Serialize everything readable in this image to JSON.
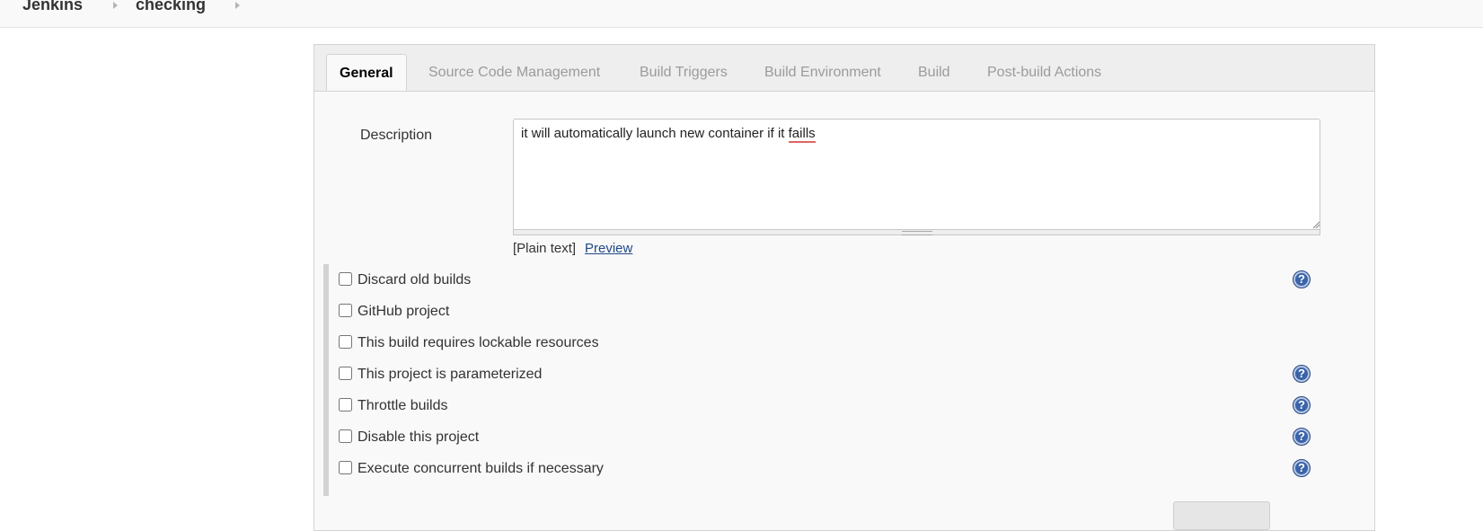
{
  "breadcrumb": {
    "items": [
      "Jenkins",
      "checking"
    ]
  },
  "tabs": [
    {
      "label": "General",
      "active": true
    },
    {
      "label": "Source Code Management",
      "active": false
    },
    {
      "label": "Build Triggers",
      "active": false
    },
    {
      "label": "Build Environment",
      "active": false
    },
    {
      "label": "Build",
      "active": false
    },
    {
      "label": "Post-build Actions",
      "active": false
    }
  ],
  "description": {
    "label": "Description",
    "text_before": "it will automatically launch new container if it ",
    "text_misspelled": "faills",
    "markup_note": "[Plain text]",
    "preview_link": "Preview"
  },
  "options": [
    {
      "label": "Discard old builds",
      "checked": false,
      "has_help": true
    },
    {
      "label": "GitHub project",
      "checked": false,
      "has_help": false
    },
    {
      "label": "This build requires lockable resources",
      "checked": false,
      "has_help": false
    },
    {
      "label": "This project is parameterized",
      "checked": false,
      "has_help": true
    },
    {
      "label": "Throttle builds",
      "checked": false,
      "has_help": true
    },
    {
      "label": "Disable this project",
      "checked": false,
      "has_help": true
    },
    {
      "label": "Execute concurrent builds if necessary",
      "checked": false,
      "has_help": true
    }
  ],
  "icons": {
    "help": "help-icon",
    "breadcrumb_separator": "chevron-right-icon",
    "resize": "resize-grip-icon"
  },
  "colors": {
    "help_icon": "#3b63a8",
    "link": "#204a87",
    "misspell_underline": "#e06464"
  }
}
